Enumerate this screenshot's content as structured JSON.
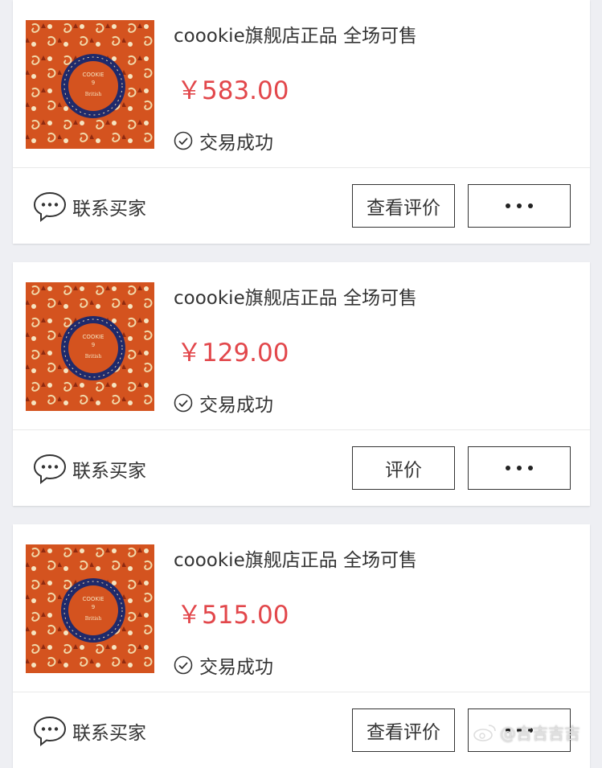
{
  "orders": [
    {
      "title": "coookie旗舰店正品 全场可售",
      "price": "￥583.00",
      "status": "交易成功",
      "contact_label": "联系买家",
      "primary_button": "查看评价"
    },
    {
      "title": "coookie旗舰店正品 全场可售",
      "price": "￥129.00",
      "status": "交易成功",
      "contact_label": "联系买家",
      "primary_button": "评价"
    },
    {
      "title": "coookie旗舰店正品 全场可售",
      "price": "￥515.00",
      "status": "交易成功",
      "contact_label": "联系买家",
      "primary_button": "查看评价"
    }
  ],
  "icons": {
    "status": "check-circle-icon",
    "contact": "chat-bubble-icon",
    "more": "more-dots-icon",
    "watermark": "weibo-icon"
  },
  "colors": {
    "price": "#e2474b",
    "product_orange": "#d4531f",
    "product_badge": "#1f2a6b"
  },
  "watermark": {
    "text": "@吉吉吉吉"
  }
}
